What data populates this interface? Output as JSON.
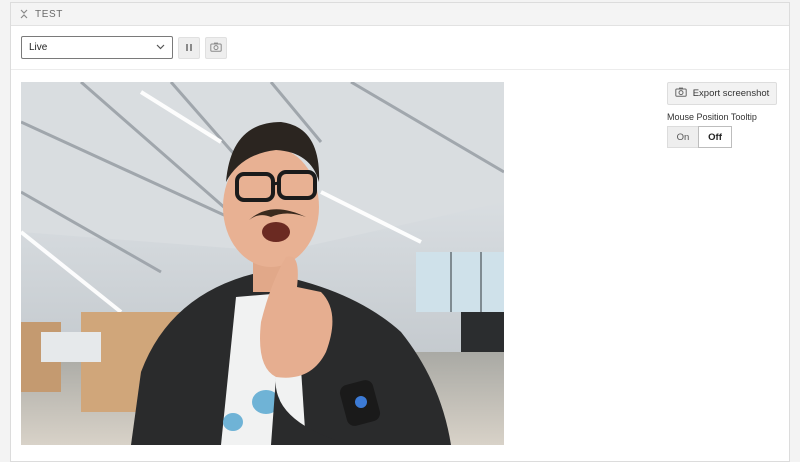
{
  "panel": {
    "title": "TEST"
  },
  "toolbar": {
    "source_select": {
      "selected": "Live"
    },
    "pause_icon": "pause-icon",
    "camera_icon": "camera-icon"
  },
  "video": {
    "description_icon": "webcam-frame"
  },
  "sidebar": {
    "export_label": "Export screenshot",
    "tooltip_label": "Mouse Position Tooltip",
    "toggle": {
      "on": "On",
      "off": "Off",
      "active": "Off"
    }
  },
  "colors": {
    "panel_bg": "#ffffff",
    "header_bg": "#f4f4f4",
    "border": "#dcdcdc"
  }
}
